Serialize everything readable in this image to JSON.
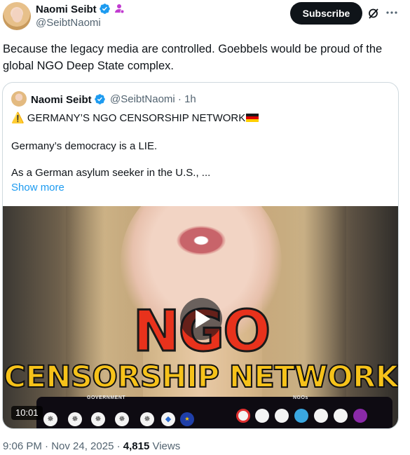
{
  "author": {
    "name": "Naomi Seibt",
    "handle": "@SeibtNaomi"
  },
  "header": {
    "subscribe_label": "Subscribe"
  },
  "tweet": {
    "text": "Because the legacy media are controlled. Goebbels would be proud of the global NGO Deep State complex.",
    "timestamp": "9:06 PM · Nov 24, 2025 · ",
    "views_count": "4,815",
    "views_label": " Views"
  },
  "quote": {
    "name": "Naomi Seibt",
    "handle_time": "@SeibtNaomi · 1h",
    "line1": "⚠️ GERMANY’S NGO CENSORSHIP NETWORK",
    "line2": "Germany’s democracy is a LIE.",
    "line3": "As a German asylum seeker in the U.S., ...",
    "show_more": "Show more"
  },
  "video": {
    "title_big": "NGO",
    "title_sub": "CENSORSHIP NETWORK",
    "duration": "10:01",
    "label_government": "GOVERNMENT",
    "label_ngos": "NGOs"
  },
  "colors": {
    "accent": "#1d9bf0",
    "verified": "#1d9bf0",
    "affiliate": "#c13bd0",
    "ngo_red": "#e8321c",
    "network_yellow": "#f6c21a"
  },
  "icons": [
    "verified-badge-icon",
    "affiliate-icon",
    "grok-icon",
    "more-icon",
    "play-icon",
    "germany-flag-icon"
  ]
}
